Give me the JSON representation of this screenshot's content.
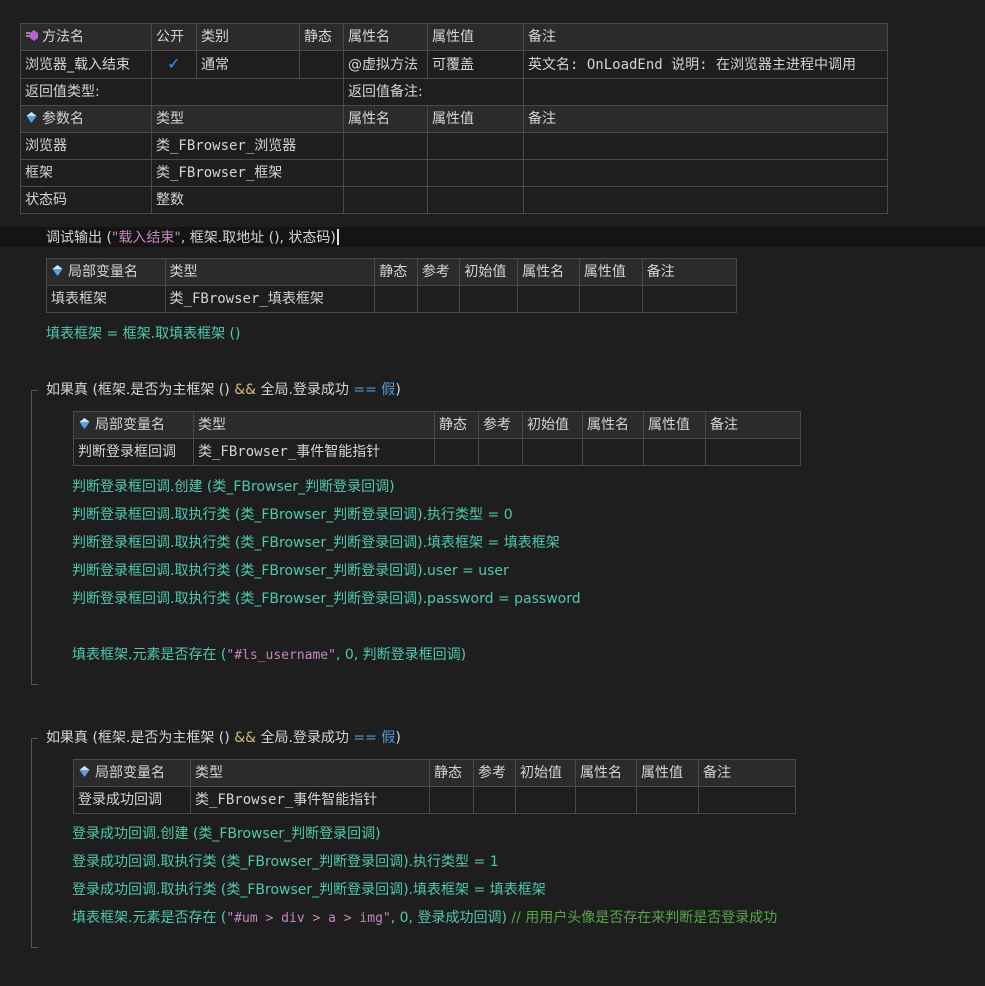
{
  "method_table": {
    "headers": [
      "方法名",
      "公开",
      "类别",
      "静态",
      "属性名",
      "属性值",
      "备注"
    ],
    "name": "浏览器_载入结束",
    "public_check": "✓",
    "category": "通常",
    "static": "",
    "attr_name": "@虚拟方法",
    "attr_value": "可覆盖",
    "remark": "英文名: OnLoadEnd 说明: 在浏览器主进程中调用",
    "return_type_label": "返回值类型:",
    "return_remark_label": "返回值备注:",
    "param_headers": [
      "参数名",
      "类型",
      "属性名",
      "属性值",
      "备注"
    ],
    "params": [
      {
        "name": "浏览器",
        "type": "类_FBrowser_浏览器"
      },
      {
        "name": "框架",
        "type": "类_FBrowser_框架"
      },
      {
        "name": "状态码",
        "type": "整数"
      }
    ]
  },
  "code": {
    "debug_line": {
      "p1": "调试输出 (",
      "s1": "\"载入结束\"",
      "p2": ", 框架.取地址 (), 状态码)"
    },
    "local1": {
      "headers": [
        "局部变量名",
        "类型",
        "静态",
        "参考",
        "初始值",
        "属性名",
        "属性值",
        "备注"
      ],
      "name": "填表框架",
      "type": "类_FBrowser_填表框架"
    },
    "assign_line": "填表框架 = 框架.取填表框架 ()",
    "if1": {
      "a": "如果真 (框架.是否为主框架 () ",
      "amp": "&&",
      "b": " 全局.登录成功 ",
      "eq": "==",
      "c": " 假",
      ")": ")"
    },
    "local2": {
      "headers": [
        "局部变量名",
        "类型",
        "静态",
        "参考",
        "初始值",
        "属性名",
        "属性值",
        "备注"
      ],
      "name": "判断登录框回调",
      "type": "类_FBrowser_事件智能指针"
    },
    "block1": [
      "判断登录框回调.创建 (类_FBrowser_判断登录回调)",
      "判断登录框回调.取执行类 (类_FBrowser_判断登录回调).执行类型 = 0",
      "判断登录框回调.取执行类 (类_FBrowser_判断登录回调).填表框架 = 填表框架",
      "判断登录框回调.取执行类 (类_FBrowser_判断登录回调).user = user",
      "判断登录框回调.取执行类 (类_FBrowser_判断登录回调).password = password"
    ],
    "exists1": {
      "a": "填表框架.元素是否存在 (",
      "s": "\"#ls_username\"",
      "b": ", 0, 判断登录框回调)"
    },
    "if2": {
      "a": "如果真 (框架.是否为主框架 () ",
      "amp": "&&",
      "b": " 全局.登录成功 ",
      "eq": "==",
      "c": " 假",
      ")": ")"
    },
    "local3": {
      "headers": [
        "局部变量名",
        "类型",
        "静态",
        "参考",
        "初始值",
        "属性名",
        "属性值",
        "备注"
      ],
      "name": "登录成功回调",
      "type": "类_FBrowser_事件智能指针"
    },
    "block2": [
      "登录成功回调.创建 (类_FBrowser_判断登录回调)",
      "登录成功回调.取执行类 (类_FBrowser_判断登录回调).执行类型 = 1",
      "登录成功回调.取执行类 (类_FBrowser_判断登录回调).填表框架 = 填表框架"
    ],
    "exists2": {
      "a": "填表框架.元素是否存在 (",
      "s": "\"#um > div > a > img\"",
      "b": ", 0, 登录成功回调)",
      "cmt": "  // 用用户头像是否存在来判断是否登录成功"
    }
  }
}
